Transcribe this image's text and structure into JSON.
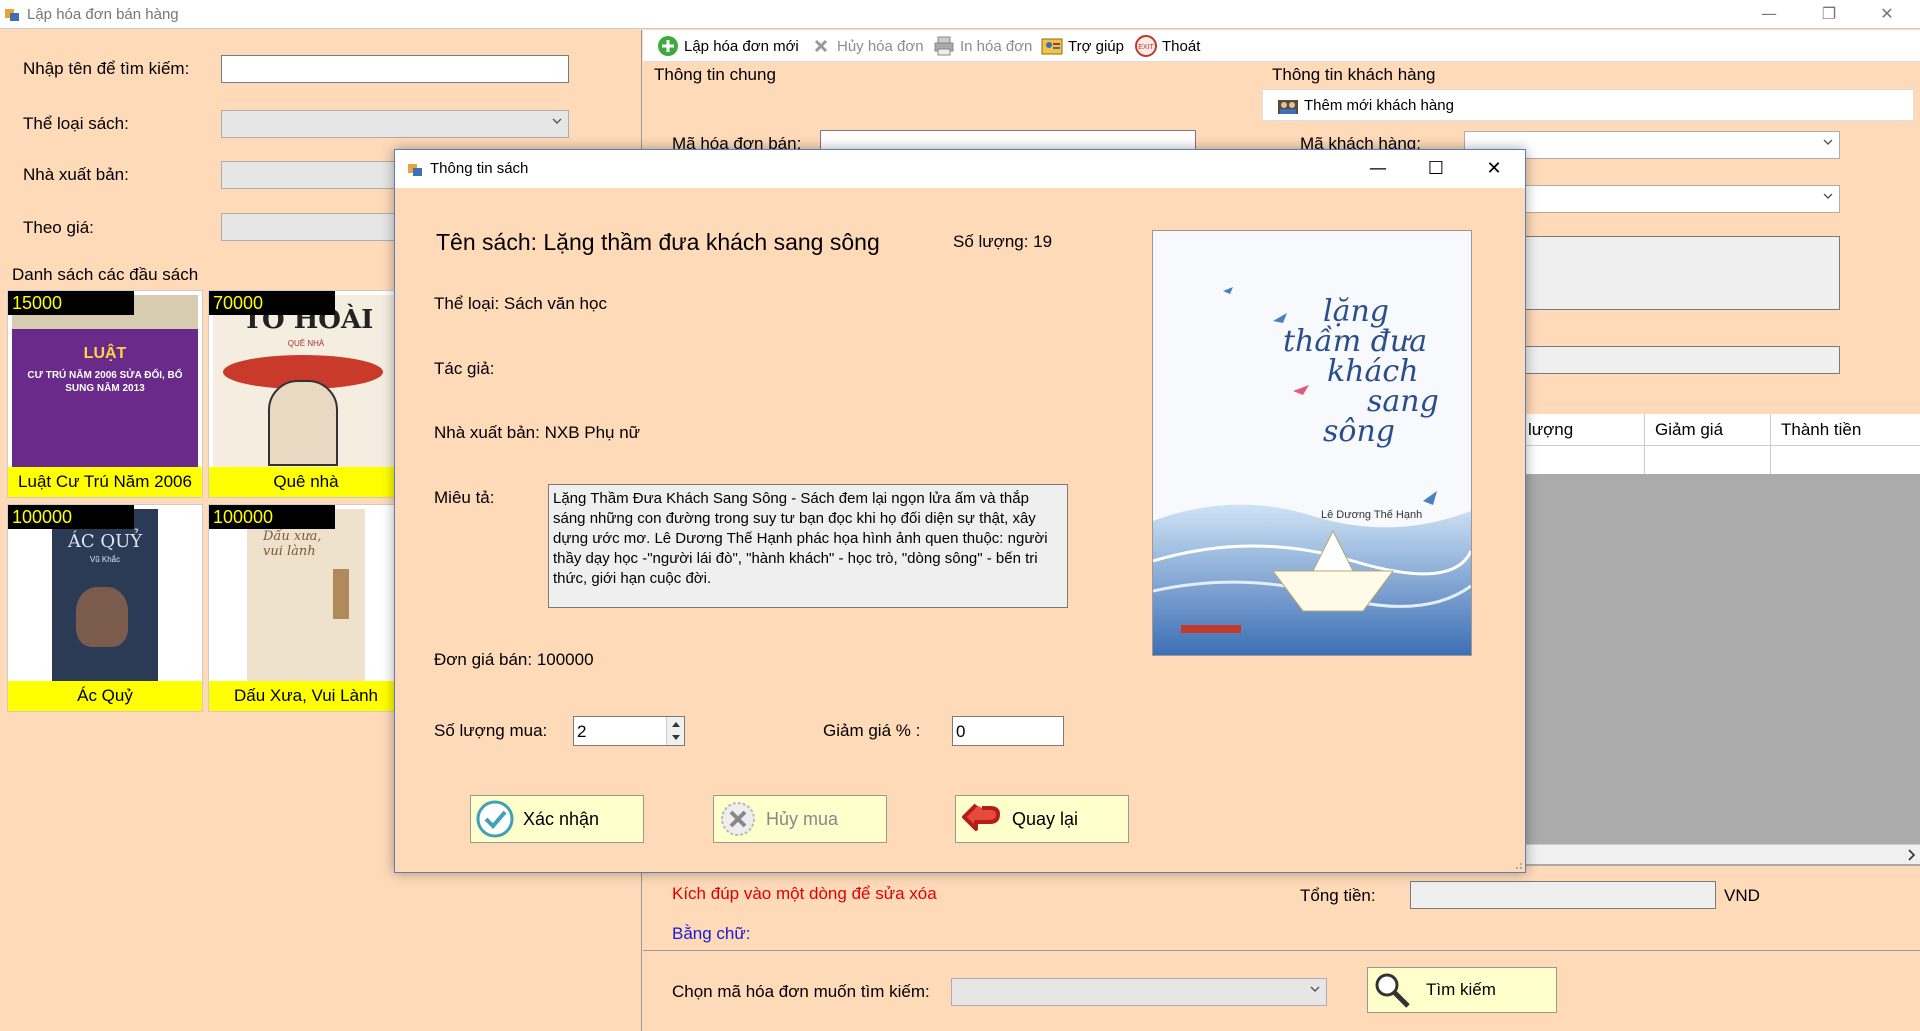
{
  "main_window": {
    "title": "Lập hóa đơn bán hàng",
    "minimize": "—",
    "restore": "❐",
    "close": "✕"
  },
  "search": {
    "name_label": "Nhập tên để tìm kiếm:",
    "name_value": "",
    "category_label": "Thể loại sách:",
    "publisher_label": "Nhà xuất bản:",
    "price_label": "Theo giá:"
  },
  "book_list": {
    "title": "Danh sách các đầu sách",
    "books": [
      {
        "price": "15000",
        "name": "Luật Cư Trú Năm 2006",
        "cover_text": "LUẬT",
        "cover_sub": "CƯ TRÚ NĂM 2006 SỬA ĐỔI, BỔ SUNG NĂM 2013"
      },
      {
        "price": "70000",
        "name": "Quê nhà",
        "cover_text": "TÔ HOÀI",
        "cover_sub": "QUÊ NHÀ"
      },
      {
        "price": "100000",
        "name": "Ác Quỷ",
        "cover_text": "ÁC QUỶ",
        "cover_sub": "Vũ Khắc"
      },
      {
        "price": "100000",
        "name": "Dấu Xưa, Vui Lành",
        "cover_text": "Dấu xưa, vui lành",
        "cover_sub": ""
      }
    ]
  },
  "toolbar": {
    "new_invoice": "Lập hóa đơn mới",
    "cancel_invoice": "Hủy hóa đơn",
    "print_invoice": "In hóa đơn",
    "help": "Trợ giúp",
    "exit": "Thoát"
  },
  "general_info": {
    "title": "Thông tin chung",
    "invoice_code_label": "Mã hóa đơn bán:"
  },
  "customer_info": {
    "title": "Thông tin khách hàng",
    "add_customer": "Thêm mới khách hàng",
    "customer_code_label": "Mã khách hàng:"
  },
  "grid": {
    "columns": [
      "lượng",
      "Giảm giá",
      "Thành tiền"
    ]
  },
  "summary": {
    "hint": "Kích đúp vào một dòng để sửa xóa",
    "total_label": "Tổng tiền:",
    "currency": "VND",
    "in_words_label": "Bằng chữ:"
  },
  "bottom": {
    "select_label": "Chọn mã hóa đơn muốn tìm kiếm:",
    "search_button": "Tìm kiếm"
  },
  "dialog": {
    "title": "Thông tin sách",
    "minimize": "—",
    "maximize": "☐",
    "close": "✕",
    "book_title": "Tên sách: Lặng thầm đưa khách sang sông",
    "quantity": "Số lượng: 19",
    "category": "Thể loại: Sách văn học",
    "author": "Tác giả:",
    "publisher": "Nhà xuất bản: NXB Phụ nữ",
    "description_label": "Miêu tả:",
    "description": "Lặng Thầm Đưa Khách Sang Sông - Sách đem lại ngọn lửa ấm và thắp sáng những con đường trong suy tư bạn đọc khi họ đối diện sự thật, xây dựng ước mơ. Lê Dương Thế Hạnh phác họa hình ảnh quen thuộc: người thầy dạy học -\"người lái đò\", \"hành khách\" - học trò, \"dòng sông\" - bến tri thức, giới hạn cuộc đời.",
    "unit_price": "Đơn giá bán: 100000",
    "buy_qty_label": "Số lượng mua:",
    "buy_qty_value": "2",
    "discount_label": "Giảm giá % :",
    "discount_value": "0",
    "confirm_button": "Xác nhận",
    "cancel_button": "Hủy mua",
    "back_button": "Quay lại",
    "cover_title_lines": [
      "lặng",
      "thầm đưa",
      "khách",
      "sang",
      "sông"
    ],
    "cover_author": "Lê Dương Thế Hạnh"
  }
}
